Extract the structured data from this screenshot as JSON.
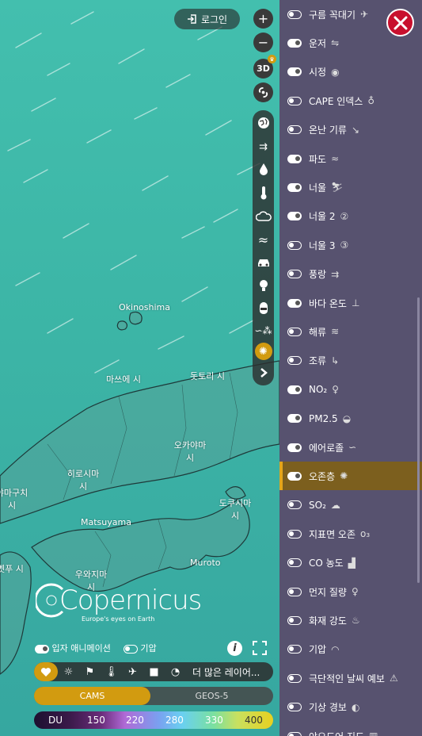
{
  "header": {
    "login_label": "로그인"
  },
  "toolbar": {
    "zoom_in": "+",
    "zoom_out": "−",
    "view_3d": "3D"
  },
  "map": {
    "labels": [
      "Okinoshima",
      "마쓰에 시",
      "돗토리 시",
      "오카야마 시",
      "히로시마 시",
      "야마구치 시",
      "도쿠시마 시",
      "Matsuyama",
      "Muroto",
      "우와지마 시",
      "벳푸 시"
    ]
  },
  "logo": {
    "name": "Copernicus",
    "tagline": "Europe's eyes on Earth"
  },
  "bottom": {
    "particle_animation": "입자 애니메이션",
    "pressure": "기압",
    "more_layers": "더 많은 레이어...",
    "models": [
      "CAMS",
      "GEOS-5"
    ],
    "legend": {
      "unit": "DU",
      "values": [
        "150",
        "220",
        "280",
        "330",
        "400"
      ]
    }
  },
  "layers": [
    {
      "label": "구름 꼭대기",
      "icon": "✈",
      "on": false
    },
    {
      "label": "운저",
      "icon": "⇋",
      "on": true
    },
    {
      "label": "시정",
      "icon": "◉",
      "on": true
    },
    {
      "label": "CAPE 인덱스",
      "icon": "♁",
      "on": false
    },
    {
      "label": "온난 기류",
      "icon": "↘",
      "on": false
    },
    {
      "label": "파도",
      "icon": "≈",
      "on": true
    },
    {
      "label": "너울",
      "icon": "⛷",
      "on": true
    },
    {
      "label": "너울 2",
      "icon": "②",
      "on": true
    },
    {
      "label": "너울 3",
      "icon": "③",
      "on": false
    },
    {
      "label": "풍랑",
      "icon": "⇉",
      "on": false
    },
    {
      "label": "바다 온도",
      "icon": "⊥",
      "on": true
    },
    {
      "label": "해류",
      "icon": "≋",
      "on": false
    },
    {
      "label": "조류",
      "icon": "↳",
      "on": false
    },
    {
      "label": "NO₂",
      "icon": "♀",
      "on": true
    },
    {
      "label": "PM2.5",
      "icon": "◒",
      "on": true
    },
    {
      "label": "에어로졸",
      "icon": "∽",
      "on": true
    },
    {
      "label": "오존층",
      "icon": "✺",
      "on": true,
      "active": true
    },
    {
      "label": "SO₂",
      "icon": "☁",
      "on": false
    },
    {
      "label": "지표면 오존",
      "icon": "o₃",
      "on": false
    },
    {
      "label": "CO 농도",
      "icon": "▟",
      "on": false
    },
    {
      "label": "먼지 질량",
      "icon": "♀",
      "on": false
    },
    {
      "label": "화재 강도",
      "icon": "♨",
      "on": false
    },
    {
      "label": "기압",
      "icon": "◠",
      "on": false
    },
    {
      "label": "극단적인 날씨 예보",
      "icon": "⚠",
      "on": false
    },
    {
      "label": "기상 경보",
      "icon": "◐",
      "on": false
    },
    {
      "label": "야오도어 지도",
      "icon": "▥",
      "on": false
    }
  ],
  "colors": {
    "panel": "#57526f",
    "accent": "#d29b10",
    "close": "#c8102e"
  }
}
